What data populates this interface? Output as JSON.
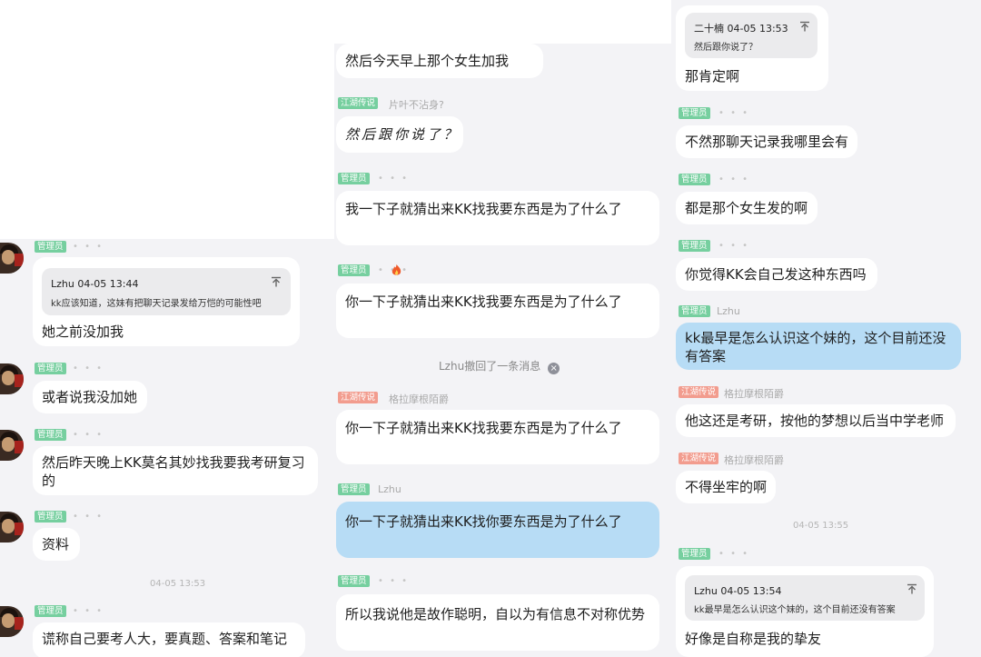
{
  "left": {
    "tag_admin": "管理员",
    "dots": "• • •",
    "quote": {
      "name": "Lzhu 04-05 13:44",
      "text": "kk应该知道，这妹有把聊天记录发给万恺的可能性吧"
    },
    "messages": [
      "她之前没加我",
      "或者说我没加她",
      "然后昨天晚上KK莫名其妙找我要我考研复习的",
      "资料",
      "谎称自己要考人大，要真题、答案和笔记"
    ],
    "timestamp": "04-05 13:53"
  },
  "middle": {
    "messages": [
      "然后今天早上那个女生加我",
      "然后跟你说了？",
      "我一下子就猜出来KK找我要东西是为了什么了",
      "你一下子就猜出来KK找我要东西是为了什么了",
      "你一下子就猜出来KK找我要东西是为了什么了",
      "你一下子就猜出来KK找你要东西是为了什么了",
      "所以我说他是故作聪明，自以为有信息不对称优势"
    ],
    "tags": {
      "jianghu": "江湖传说",
      "admin": "管理员"
    },
    "nicks": {
      "pianye": "片叶不沾身?",
      "gela": "格拉摩根陌爵",
      "lzhu": "Lzhu"
    },
    "dots": "• • •",
    "recall": "Lzhu撤回了一条消息",
    "recall_icon": "×"
  },
  "right": {
    "quote1": {
      "name": "二十楠 04-05 13:53",
      "text": "然后跟你说了？"
    },
    "messages": [
      "那肯定啊",
      "不然那聊天记录我哪里会有",
      "都是那个女生发的啊",
      "你觉得KK会自己发这种东西吗",
      "kk最早是怎么认识这个妹的，这个目前还没有答案",
      "他这还是考研，按他的梦想以后当中学老师",
      "不得坐牢的啊",
      "好像是自称是我的挚友"
    ],
    "tags": {
      "admin": "管理员",
      "jianghu": "江湖传说"
    },
    "nicks": {
      "lzhu": "Lzhu",
      "gela": "格拉摩根陌爵"
    },
    "dots": "• • •",
    "timestamp": "04-05 13:55",
    "quote2": {
      "name": "Lzhu 04-05 13:54",
      "text": "kk最早是怎么认识这个妹的，这个目前还没有答案"
    }
  },
  "colors": {
    "background": "#f3f3f6",
    "bubble": "#ffffff",
    "self_bubble": "#b7dcf5",
    "admin_tag": "#76cf9f",
    "jianghu_tag": "#f29c8e"
  },
  "icons": [
    "avatar",
    "pin-to-top-icon",
    "close-circle-icon",
    "fire-emoji-icon"
  ]
}
